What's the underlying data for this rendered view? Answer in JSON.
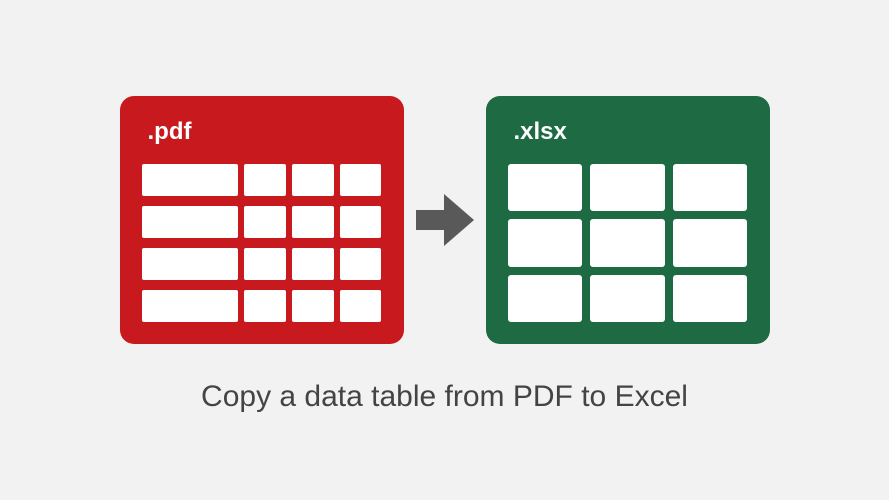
{
  "source": {
    "label": ".pdf",
    "color": "#c8191e",
    "grid": {
      "cols": 4,
      "rows": 4
    }
  },
  "target": {
    "label": ".xlsx",
    "color": "#1e6b43",
    "grid": {
      "cols": 3,
      "rows": 3
    }
  },
  "arrow": {
    "color": "#595959"
  },
  "caption": "Copy a data table from PDF to Excel"
}
